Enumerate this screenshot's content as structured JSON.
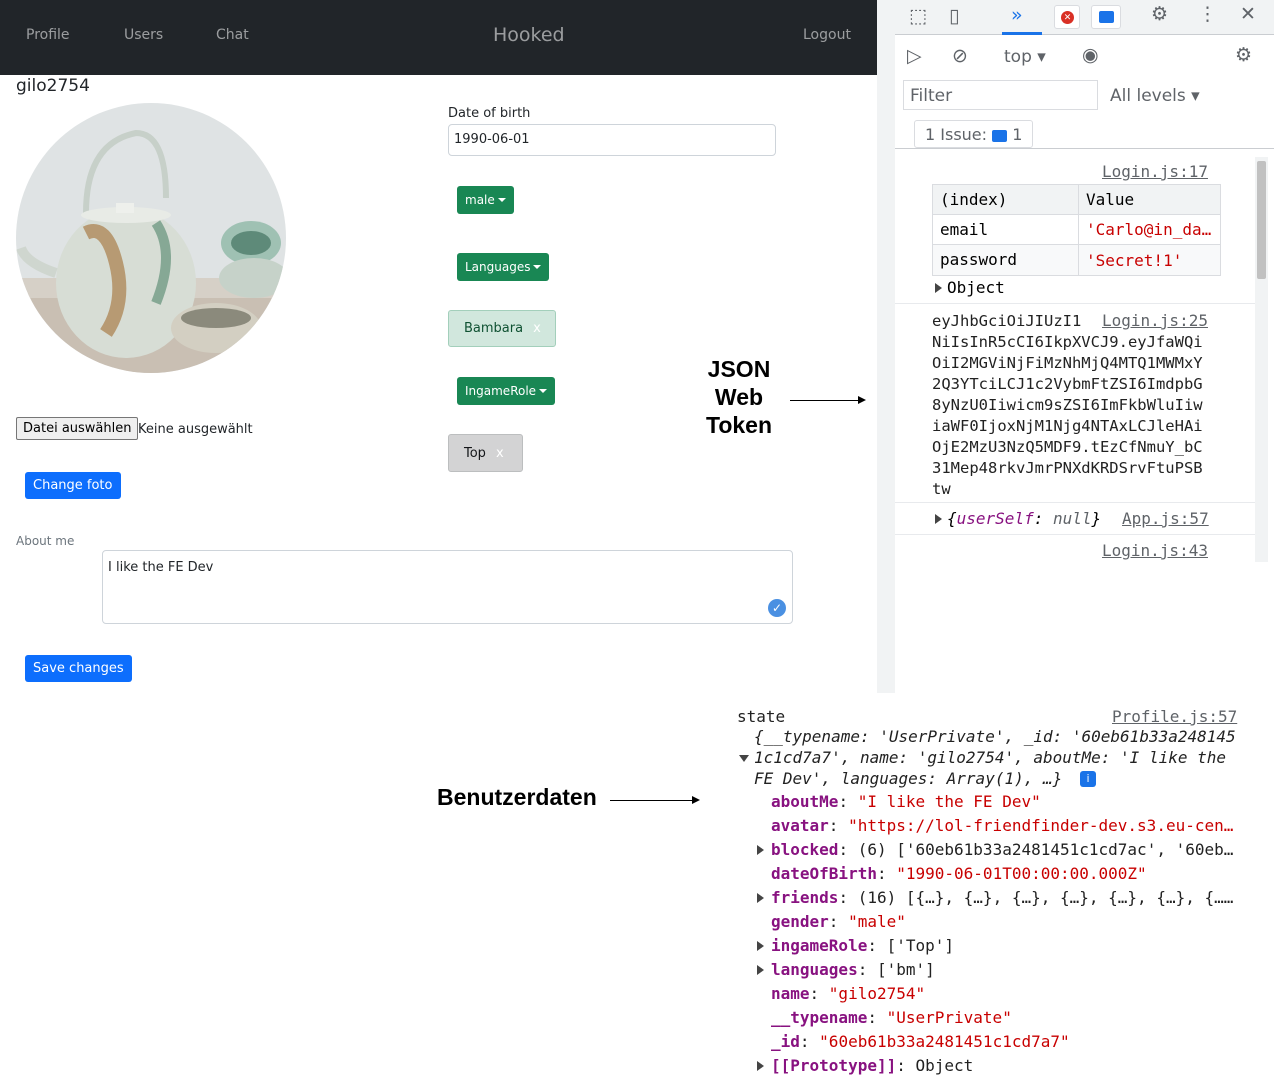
{
  "app": {
    "nav": {
      "profile": "Profile",
      "users": "Users",
      "chat": "Chat",
      "brand": "Hooked",
      "logout": "Logout"
    },
    "username": "gilo2754",
    "dob_label": "Date of birth",
    "dob_value": "1990-06-01",
    "gender_btn": "male",
    "languages_btn": "Languages",
    "language_chip": "Bambara",
    "ingame_btn": "IngameRole",
    "role_chip": "Top",
    "chip_remove": "x",
    "file_button": "Datei auswählen",
    "file_status": "Keine ausgewählt",
    "change_foto": "Change foto",
    "about_label": "About me",
    "about_value": "I like the FE Dev",
    "save_changes": "Save changes",
    "colors": {
      "navbar": "#212529",
      "green": "#198754",
      "blue": "#0d6efd"
    }
  },
  "devtools": {
    "context": "top",
    "filter_placeholder": "Filter",
    "levels": "All levels",
    "issues": "1 Issue:",
    "issues_count": "1",
    "entry1": {
      "source": "Login.js:17",
      "table_headers": [
        "(index)",
        "Value"
      ],
      "rows": [
        {
          "key": "email",
          "value": "'Carlo@in_da…"
        },
        {
          "key": "password",
          "value": "'Secret!1'"
        }
      ],
      "object_label": "Object"
    },
    "entry2": {
      "source": "Login.js:25",
      "token_lines": [
        "eyJhbGciOiJIUzI1",
        "NiIsInR5cCI6IkpXVCJ9.eyJfaWQi",
        "OiI2MGViNjFiMzNhMjQ4MTQ1MWMxY",
        "2Q3YTciLCJ1c2VybmFtZSI6ImdpbG",
        "8yNzU0Iiwicm9sZSI6ImFkbWluIiw",
        "iaWF0IjoxNjM1Njg4NTAxLCJleHAi",
        "OjE2MzU3NzQ5MDF9.tEzCfNmuY_bC",
        "31Mep48rkvJmrPNXdKRDSrvFtuPSB",
        "tw"
      ]
    },
    "entry3": {
      "source": "App.js:57",
      "key": "userSelf",
      "value": "null"
    },
    "entry4": {
      "source": "Login.js:43"
    }
  },
  "annotations": {
    "jwt": [
      "JSON",
      "Web",
      "Token"
    ],
    "user_data": "Benutzerdaten"
  },
  "state": {
    "label": "state",
    "source": "Profile.js:57",
    "summary_1": "{__typename: 'UserPrivate', _id: '60eb61b33a248145",
    "summary_2": "1c1cd7a7', name: 'gilo2754', aboutMe: 'I like the",
    "summary_3": "FE Dev', languages: Array(1), …}",
    "props": [
      {
        "key": "aboutMe",
        "value": "\"I like the FE Dev\"",
        "expand": false
      },
      {
        "key": "avatar",
        "value": "\"https://lol-friendfinder-dev.s3.eu-cen…",
        "expand": false
      },
      {
        "key": "blocked",
        "value": "(6) ['60eb61b33a2481451c1cd7ac', '60eb…",
        "expand": true
      },
      {
        "key": "dateOfBirth",
        "value": "\"1990-06-01T00:00:00.000Z\"",
        "expand": false
      },
      {
        "key": "friends",
        "value": "(16) [{…}, {…}, {…}, {…}, {…}, {…}, {……",
        "expand": true
      },
      {
        "key": "gender",
        "value": "\"male\"",
        "expand": false
      },
      {
        "key": "ingameRole",
        "value": "['Top']",
        "expand": true
      },
      {
        "key": "languages",
        "value": "['bm']",
        "expand": true
      },
      {
        "key": "name",
        "value": "\"gilo2754\"",
        "expand": false
      },
      {
        "key": "__typename",
        "value": "\"UserPrivate\"",
        "expand": false
      },
      {
        "key": "_id",
        "value": "\"60eb61b33a2481451c1cd7a7\"",
        "expand": false
      },
      {
        "key": "[[Prototype]]",
        "value": "Object",
        "expand": true
      }
    ]
  }
}
